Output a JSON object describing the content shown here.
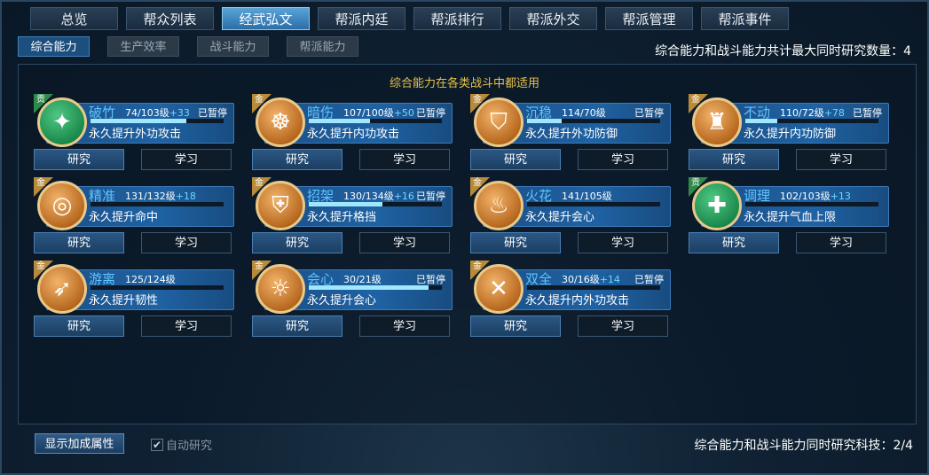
{
  "top_tabs": [
    {
      "label": "总览"
    },
    {
      "label": "帮众列表"
    },
    {
      "label": "经武弘文",
      "active": true
    },
    {
      "label": "帮派内廷"
    },
    {
      "label": "帮派排行"
    },
    {
      "label": "帮派外交"
    },
    {
      "label": "帮派管理"
    },
    {
      "label": "帮派事件"
    }
  ],
  "sub_tabs": [
    {
      "label": "综合能力",
      "active": true
    },
    {
      "label": "生产效率"
    },
    {
      "label": "战斗能力"
    },
    {
      "label": "帮派能力"
    }
  ],
  "max_research_note": "综合能力和战斗能力共计最大同时研究数量：4",
  "panel_description": "综合能力在各类战斗中都适用",
  "buttons": {
    "research": "研究",
    "learn": "学习"
  },
  "skills": [
    {
      "grade": "贡",
      "color": "green",
      "icon": "crossed-swords-icon",
      "glyph": "✦",
      "name": "破竹",
      "level": "74/103级",
      "bonus": "+33",
      "status": "已暂停",
      "progress": 0.72,
      "desc": "永久提升外功攻击"
    },
    {
      "grade": "金",
      "color": "gold",
      "icon": "meditating-figure-icon",
      "glyph": "☸",
      "name": "暗伤",
      "level": "107/100级",
      "bonus": "+50",
      "status": "已暂停",
      "progress": 0.46,
      "desc": "永久提升内功攻击"
    },
    {
      "grade": "金",
      "color": "gold",
      "icon": "shield-arrow-icon",
      "glyph": "⛉",
      "name": "沉稳",
      "level": "114/70级",
      "bonus": "",
      "status": "已暂停",
      "progress": 0.26,
      "desc": "永久提升外功防御"
    },
    {
      "grade": "金",
      "color": "gold",
      "icon": "armor-figure-icon",
      "glyph": "♜",
      "name": "不动",
      "level": "110/72级",
      "bonus": "+78",
      "status": "已暂停",
      "progress": 0.24,
      "desc": "永久提升内功防御"
    },
    {
      "grade": "金",
      "color": "gold",
      "icon": "target-icon",
      "glyph": "◎",
      "name": "精准",
      "level": "131/132级",
      "bonus": "+18",
      "status": "",
      "progress": 0,
      "desc": "永久提升命中"
    },
    {
      "grade": "金",
      "color": "gold",
      "icon": "blocking-shield-icon",
      "glyph": "⛨",
      "name": "招架",
      "level": "130/134级",
      "bonus": "+16",
      "status": "已暂停",
      "progress": 0.55,
      "desc": "永久提升格挡"
    },
    {
      "grade": "金",
      "color": "gold",
      "icon": "flame-sword-icon",
      "glyph": "♨",
      "name": "火花",
      "level": "141/105级",
      "bonus": "",
      "status": "",
      "progress": 0,
      "desc": "永久提升会心"
    },
    {
      "grade": "贡",
      "color": "green",
      "icon": "healing-figure-icon",
      "glyph": "✚",
      "name": "调理",
      "level": "102/103级",
      "bonus": "+13",
      "status": "",
      "progress": 0,
      "desc": "永久提升气血上限"
    },
    {
      "grade": "金",
      "color": "gold",
      "icon": "dodging-blade-icon",
      "glyph": "➶",
      "name": "游离",
      "level": "125/124级",
      "bonus": "",
      "status": "",
      "progress": 0,
      "desc": "永久提升韧性"
    },
    {
      "grade": "金",
      "color": "gold",
      "icon": "glowing-figure-icon",
      "glyph": "☼",
      "name": "会心",
      "level": "30/21级",
      "bonus": "",
      "status": "已暂停",
      "progress": 0.9,
      "desc": "永久提升会心"
    },
    {
      "grade": "金",
      "color": "gold",
      "icon": "twin-swords-icon",
      "glyph": "✕",
      "name": "双全",
      "level": "30/16级",
      "bonus": "+14",
      "status": "已暂停",
      "progress": 0.0,
      "desc": "永久提升内外功攻击"
    }
  ],
  "bottom": {
    "show_attr_button": "显示加成属性",
    "auto_research": "自动研究",
    "auto_research_checked": true,
    "concurrent_note": "综合能力和战斗能力同时研究科技：2/4"
  }
}
